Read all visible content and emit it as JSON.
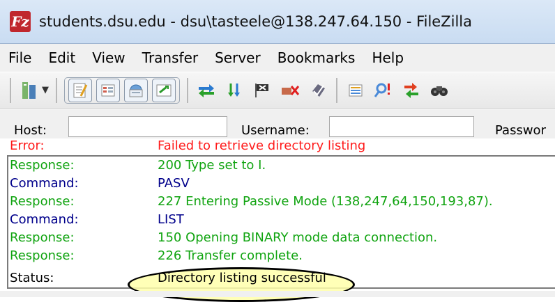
{
  "window": {
    "title": "students.dsu.edu - dsu\\tasteele@138.247.64.150 - FileZilla",
    "app_icon_letter": "Fz",
    "app_icon": "filezilla-logo-icon"
  },
  "menu": {
    "items": [
      "File",
      "Edit",
      "View",
      "Transfer",
      "Server",
      "Bookmarks",
      "Help"
    ]
  },
  "toolbar": {
    "buttons": [
      {
        "name": "site-manager-icon",
        "glyph": "🖧"
      },
      {
        "name": "toggle-log-icon",
        "glyph": "📝"
      },
      {
        "name": "toggle-local-tree-icon",
        "glyph": "☷"
      },
      {
        "name": "toggle-remote-tree-icon",
        "glyph": "📁"
      },
      {
        "name": "toggle-queue-icon",
        "glyph": "⇄"
      },
      {
        "name": "refresh-icon",
        "glyph": "⇄"
      },
      {
        "name": "process-queue-icon",
        "glyph": "⇊"
      },
      {
        "name": "cancel-operation-icon",
        "glyph": "⚑"
      },
      {
        "name": "disconnect-icon",
        "glyph": "✖"
      },
      {
        "name": "reconnect-icon",
        "glyph": "✔"
      },
      {
        "name": "directory-filters-icon",
        "glyph": "▤"
      },
      {
        "name": "directory-comparison-icon",
        "glyph": "⚲"
      },
      {
        "name": "synchronized-browsing-icon",
        "glyph": "⇆"
      },
      {
        "name": "search-remote-files-icon",
        "glyph": "⊛"
      }
    ]
  },
  "quickconnect": {
    "host_label": "Host:",
    "username_label": "Username:",
    "password_label": "Passwor",
    "host_value": "",
    "username_value": ""
  },
  "log": {
    "header": {
      "type": "Error:",
      "message": "Failed to retrieve directory listing"
    },
    "rows": [
      {
        "type": "Response:",
        "message": "200 Type set to I.",
        "kind": "response"
      },
      {
        "type": "Command:",
        "message": "PASV",
        "kind": "command"
      },
      {
        "type": "Response:",
        "message": "227 Entering Passive Mode (138,247,64,150,193,87).",
        "kind": "response"
      },
      {
        "type": "Command:",
        "message": "LIST",
        "kind": "command"
      },
      {
        "type": "Response:",
        "message": "150 Opening BINARY mode data connection.",
        "kind": "response"
      },
      {
        "type": "Response:",
        "message": "226 Transfer complete.",
        "kind": "response"
      },
      {
        "type": "Status:",
        "message": "Directory listing successful",
        "kind": "status"
      }
    ]
  },
  "colors": {
    "error": "#ff1a1a",
    "response": "#11a411",
    "command": "#00008b",
    "status": "#000000",
    "highlight_fill": "#ffffaa"
  }
}
